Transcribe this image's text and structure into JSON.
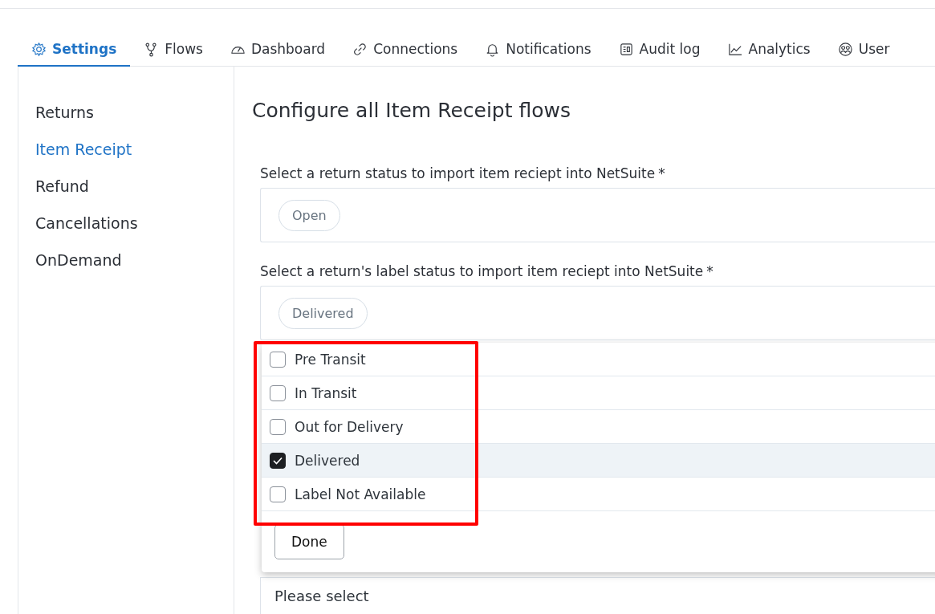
{
  "tabs": [
    {
      "label": "Settings",
      "selected": true
    },
    {
      "label": "Flows",
      "selected": false
    },
    {
      "label": "Dashboard",
      "selected": false
    },
    {
      "label": "Connections",
      "selected": false
    },
    {
      "label": "Notifications",
      "selected": false
    },
    {
      "label": "Audit log",
      "selected": false
    },
    {
      "label": "Analytics",
      "selected": false
    },
    {
      "label": "User",
      "selected": false
    }
  ],
  "sidebar": {
    "items": [
      {
        "label": "Returns",
        "selected": false
      },
      {
        "label": "Item Receipt",
        "selected": true
      },
      {
        "label": "Refund",
        "selected": false
      },
      {
        "label": "Cancellations",
        "selected": false
      },
      {
        "label": "OnDemand",
        "selected": false
      }
    ]
  },
  "main": {
    "title": "Configure all Item Receipt flows",
    "fields": [
      {
        "label": "Select a return status to import item reciept into NetSuite",
        "required_mark": "*",
        "chips": [
          "Open"
        ]
      },
      {
        "label": "Select a return's label status to import item reciept into NetSuite",
        "required_mark": "*",
        "chips": [
          "Delivered"
        ]
      }
    ],
    "dropdown": {
      "options": [
        {
          "label": "Pre Transit",
          "checked": false
        },
        {
          "label": "In Transit",
          "checked": false
        },
        {
          "label": "Out for Delivery",
          "checked": false
        },
        {
          "label": "Delivered",
          "checked": true
        },
        {
          "label": "Label Not Available",
          "checked": false
        }
      ],
      "button": "Done"
    },
    "next_field": {
      "placeholder": "Please select"
    }
  }
}
